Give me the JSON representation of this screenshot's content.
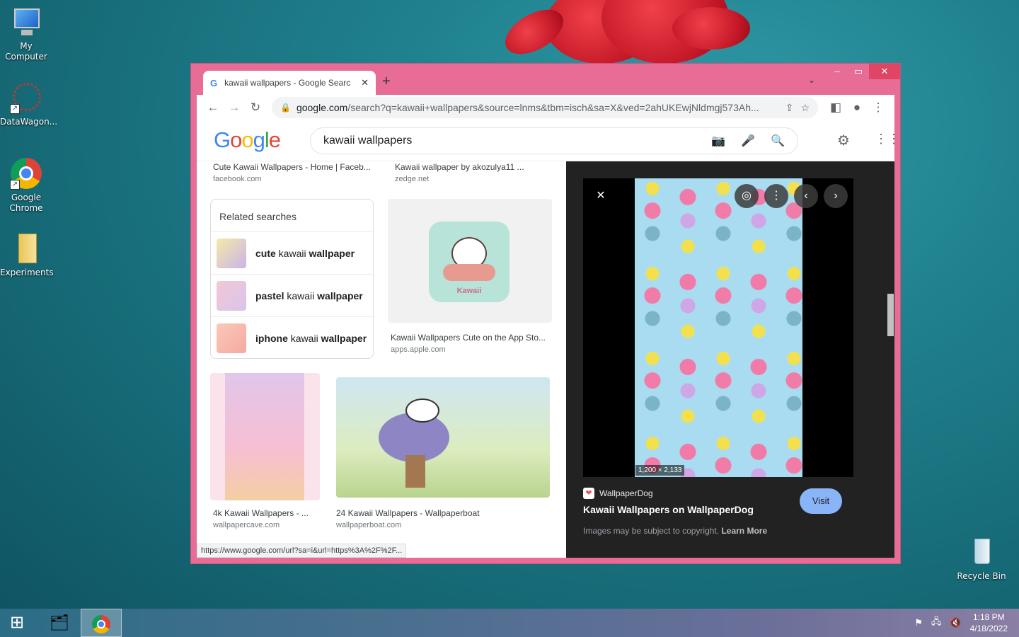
{
  "desktop": {
    "icons": [
      {
        "label": "My Computer"
      },
      {
        "label": "DataWagon..."
      },
      {
        "label": "Google Chrome"
      },
      {
        "label": "Experiments"
      },
      {
        "label": "Recycle Bin"
      }
    ]
  },
  "browser": {
    "tab_title": "kawaii wallpapers - Google Searc",
    "url_host": "google.com",
    "url_path": "/search?q=kawaii+wallpapers&source=lnms&tbm=isch&sa=X&ved=2ahUKEwjNldmgj573Ah...",
    "status_url": "https://www.google.com/url?sa=i&url=https%3A%2F%2F..."
  },
  "google": {
    "logo": "Google",
    "query": "kawaii wallpapers"
  },
  "results": {
    "top_captions": [
      {
        "title": "Cute Kawaii Wallpapers - Home | Faceb...",
        "source": "facebook.com"
      },
      {
        "title": "Kawaii wallpaper by akozulya11 ...",
        "source": "zedge.net"
      }
    ],
    "related": {
      "heading": "Related searches",
      "items": [
        {
          "bold1": "cute",
          "normal": " kawaii ",
          "bold2": "wallpaper"
        },
        {
          "bold1": "pastel",
          "normal": " kawaii ",
          "bold2": "wallpaper"
        },
        {
          "bold1": "iphone",
          "normal": " kawaii ",
          "bold2": "wallpaper"
        }
      ]
    },
    "app_result": {
      "title": "Kawaii Wallpapers Cute on the App Sto...",
      "source": "apps.apple.com",
      "logo_text": "Kawaii"
    },
    "bottom": [
      {
        "title": "4k Kawaii Wallpapers - ...",
        "source": "wallpapercave.com"
      },
      {
        "title": "24 Kawaii Wallpapers - Wallpaperboat",
        "source": "wallpaperboat.com"
      }
    ]
  },
  "preview": {
    "dimensions": "1,200 × 2,133",
    "site": "WallpaperDog",
    "title": "Kawaii Wallpapers on WallpaperDog",
    "visit_label": "Visit",
    "copyright_text": "Images may be subject to copyright.",
    "learn_more": "Learn More"
  },
  "taskbar": {
    "time": "1:18 PM",
    "date": "4/18/2022"
  },
  "colors": {
    "window_frame": "#e76d97",
    "preview_bg": "#222222",
    "visit_button": "#8ab4f8"
  }
}
